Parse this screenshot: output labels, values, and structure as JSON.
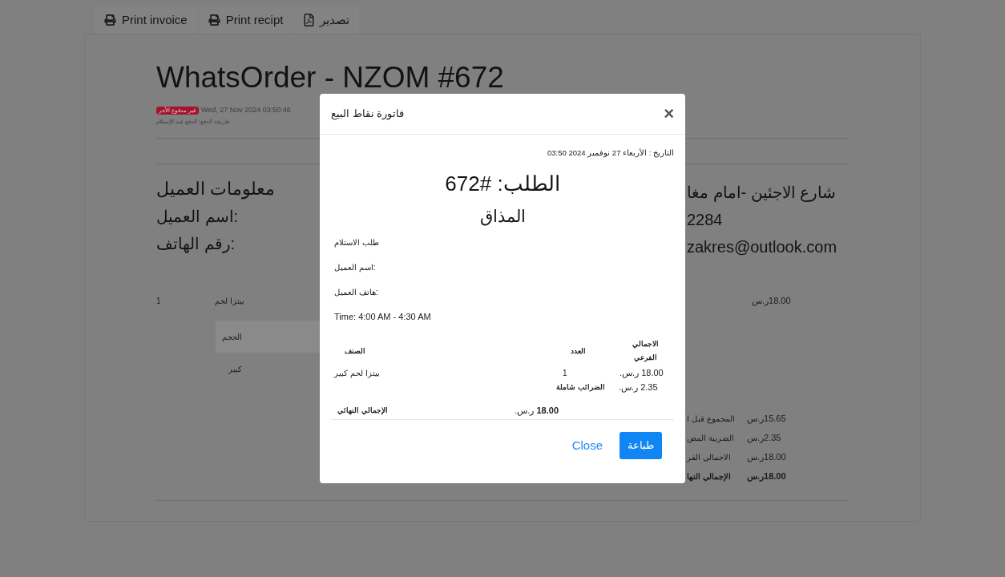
{
  "toolbar": {
    "buttons": [
      {
        "kind": "pdf",
        "label": "تصدير"
      },
      {
        "kind": "print",
        "label": "Print recipt"
      },
      {
        "kind": "print",
        "label": "Print invoice"
      }
    ]
  },
  "invoice": {
    "title": "WhatsOrder - NZOM #672",
    "status_badge": "غير مدفوع الأجر",
    "date": "Wed, 27 Nov 2024 03:50:46",
    "payment_method": "طريقة الدفع: الدفع عند الإستلام",
    "customer": {
      "heading": "معلومات العميل",
      "name_label": "اسم العميل:",
      "phone_label": "رقم الهاتف:"
    },
    "store": [
      "شارع الاجئين -امام مغا",
      "2284",
      "zakres@outlook.com"
    ],
    "items": [
      {
        "qty": "1",
        "name": "بيتزا لحم",
        "price": "18.00ر.س"
      }
    ],
    "option": {
      "header": "الحجم",
      "value": "كبير"
    },
    "summary": [
      {
        "label": "المجموع قبل ا",
        "value": "15.65ر.س",
        "bold": false
      },
      {
        "label": "الضريبة المض",
        "value": "2.35ر.س",
        "bold": false
      },
      {
        "label": "الاجمالي الفر",
        "value": "18.00ر.س",
        "bold": false
      },
      {
        "label": "الإجمالي النها",
        "value": "18.00ر.س",
        "bold": true
      }
    ]
  },
  "modal": {
    "title": "فاتورة نقاط البيع",
    "close": "×",
    "date": "التاريخ : الأربعاء 27 نوفمبر 2024 03:50",
    "order": "الطلب: #672",
    "store_name": "المذاق",
    "details": [
      "طلب الاستلام",
      "اسم العميل:",
      "هاتف العميل:"
    ],
    "time": "Time: 4:00 AM - 4:30 AM",
    "table": {
      "columns": [
        "الاجمالي الفرعي",
        "العدد",
        "الصنف"
      ],
      "rows": [
        {
          "kind": "item",
          "name": "بيتزا لحم كبير",
          "qty": "1",
          "amount": "18.00 ر.س."
        },
        {
          "kind": "tax",
          "label": "الضرائب شاملة",
          "amount": "2.35 ر.س."
        }
      ]
    },
    "total": {
      "label": "الإجمالي النهائي",
      "amount": "**18.00** ر.س."
    },
    "buttons": [
      {
        "kind": "primary",
        "label": "طباعة"
      },
      {
        "kind": "link",
        "label": "Close"
      }
    ]
  }
}
